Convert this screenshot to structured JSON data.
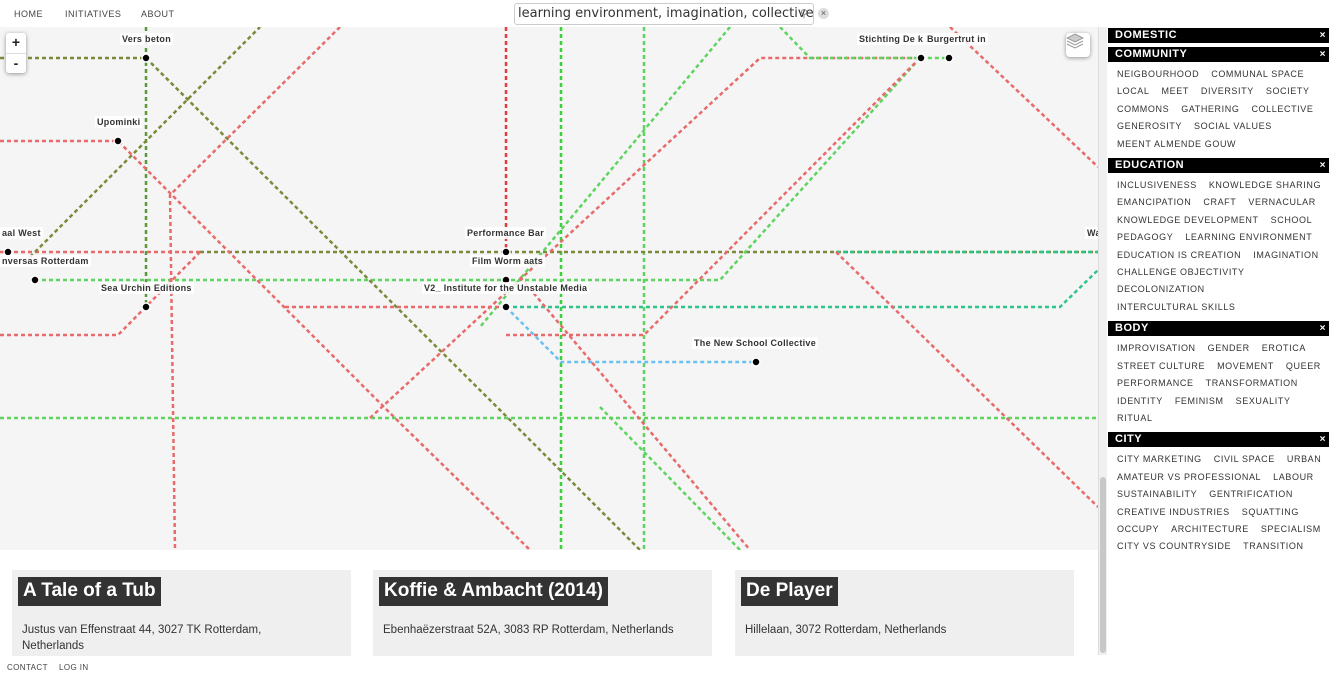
{
  "nav": {
    "home": "HOME",
    "initiatives": "INITIATIVES",
    "about": "ABOUT"
  },
  "search": {
    "value": "learning environment, imagination, collective, urban,",
    "clear": "×"
  },
  "map": {
    "zoom_in": "+",
    "zoom_out": "-",
    "stations": [
      "Vers beton",
      "Upominki",
      "Stichting De k",
      "Burgertrut in",
      "aal West",
      "nversas Rotterdam",
      "Sea Urchin Editions",
      "Performance Bar",
      "Film Worm aats",
      "V2_ Institute for the Unstable Media",
      "The New School Collective",
      "Wa"
    ],
    "line_colors": {
      "red": "#e86a6a",
      "green": "#5fd35f",
      "olive": "#7a8a3a",
      "teal": "#2ec48a",
      "blue": "#6ac0f0"
    }
  },
  "sidebar": [
    {
      "title": "DOMESTIC",
      "close": "×",
      "tags": []
    },
    {
      "title": "COMMUNITY",
      "close": "×",
      "tags": [
        "NEIGBOURHOOD",
        "COMMUNAL SPACE",
        "LOCAL",
        "MEET",
        "DIVERSITY",
        "SOCIETY",
        "COMMONS",
        "GATHERING",
        "COLLECTIVE",
        "GENEROSITY",
        "SOCIAL VALUES",
        "MEENT ALMENDE GOUW"
      ]
    },
    {
      "title": "EDUCATION",
      "close": "×",
      "tags": [
        "INCLUSIVENESS",
        "KNOWLEDGE SHARING",
        "EMANCIPATION",
        "CRAFT",
        "VERNACULAR",
        "KNOWLEDGE DEVELOPMENT",
        "SCHOOL",
        "PEDAGOGY",
        "LEARNING ENVIRONMENT",
        "EDUCATION IS CREATION",
        "IMAGINATION",
        "CHALLENGE OBJECTIVITY",
        "DECOLONIZATION",
        "INTERCULTURAL SKILLS"
      ]
    },
    {
      "title": "BODY",
      "close": "×",
      "tags": [
        "IMPROVISATION",
        "GENDER",
        "EROTICA",
        "STREET CULTURE",
        "MOVEMENT",
        "QUEER",
        "PERFORMANCE",
        "TRANSFORMATION",
        "IDENTITY",
        "FEMINISM",
        "SEXUALITY",
        "RITUAL"
      ]
    },
    {
      "title": "CITY",
      "close": "×",
      "tags": [
        "CITY MARKETING",
        "CIVIL SPACE",
        "URBAN",
        "AMATEUR VS PROFESSIONAL",
        "LABOUR",
        "SUSTAINABILITY",
        "GENTRIFICATION",
        "CREATIVE INDUSTRIES",
        "SQUATTING",
        "OCCUPY",
        "ARCHITECTURE",
        "SPECIALISM",
        "CITY VS COUNTRYSIDE",
        "TRANSITION"
      ]
    }
  ],
  "cards": [
    {
      "title": "A Tale of a Tub",
      "address": "Justus van Effenstraat 44, 3027 TK Rotterdam, Netherlands"
    },
    {
      "title": "Koffie & Ambacht (2014)",
      "address": "Ebenhaëzerstraat 52A, 3083 RP Rotterdam, Netherlands"
    },
    {
      "title": "De Player",
      "address": "Hillelaan, 3072 Rotterdam, Netherlands"
    }
  ],
  "footer": {
    "contact": "CONTACT",
    "login": "LOG IN"
  }
}
